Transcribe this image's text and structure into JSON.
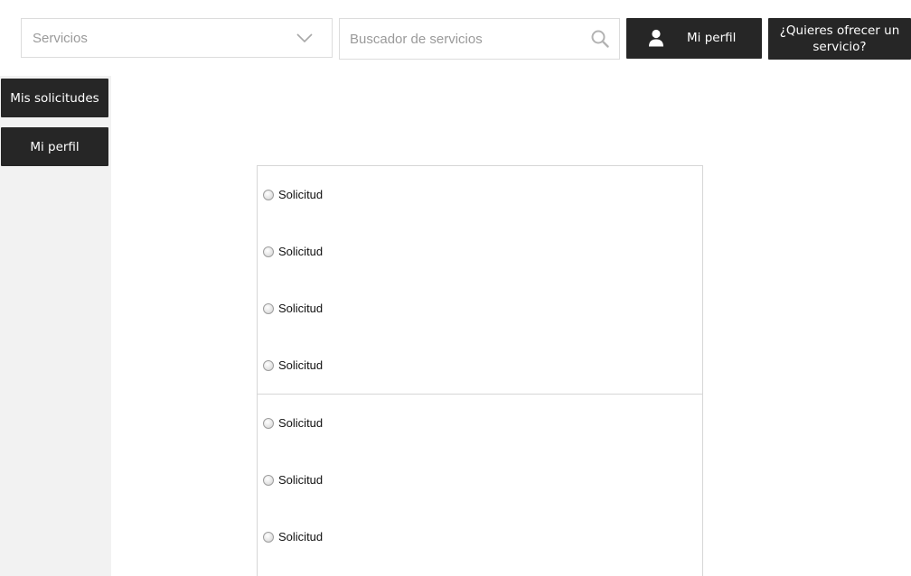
{
  "header": {
    "services_select": {
      "value": "Servicios"
    },
    "search": {
      "placeholder": "Buscador de servicios"
    },
    "profile_button": {
      "label": "Mi perfil",
      "icon": "user-icon"
    },
    "offer_button": {
      "label": "¿Quieres ofrecer un servicio?"
    }
  },
  "sidebar": {
    "items": [
      {
        "label": "Mis solicitudes"
      },
      {
        "label": "Mi perfil"
      }
    ]
  },
  "requests": {
    "items": [
      {
        "label": "Solicitud"
      },
      {
        "label": "Solicitud"
      },
      {
        "label": "Solicitud"
      },
      {
        "label": "Solicitud"
      },
      {
        "label": "Solicitud"
      },
      {
        "label": "Solicitud"
      },
      {
        "label": "Solicitud"
      }
    ]
  },
  "colors": {
    "dark_button": "#262626",
    "sidebar_bg": "#f2f2f2",
    "border": "#dcdcdc"
  }
}
